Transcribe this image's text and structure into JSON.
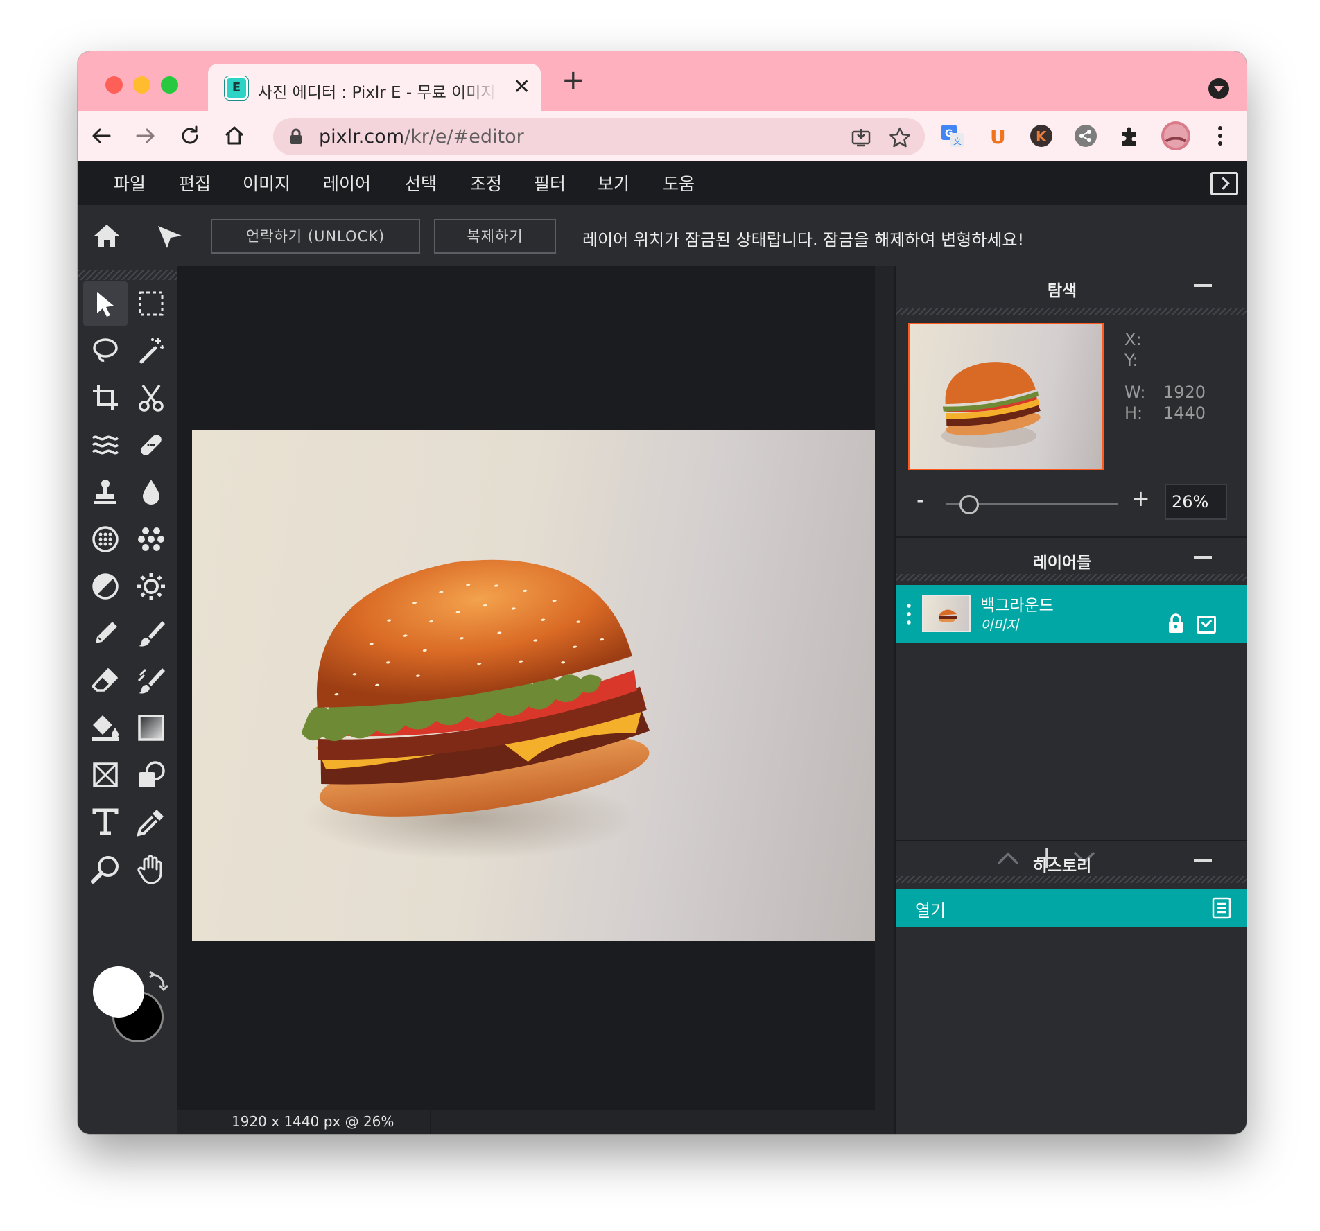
{
  "browser": {
    "tab_title": "사진 에디터 : Pixlr E - 무료 이미지 편집기",
    "tab_favicon_letter": "E",
    "new_tab_label": "+",
    "close_tab_label": "✕",
    "url_host": "pixlr.com",
    "url_path": "/kr/e/#editor"
  },
  "menu": {
    "items": [
      "파일",
      "편집",
      "이미지",
      "레이어",
      "선택",
      "조정",
      "필터",
      "보기",
      "도움"
    ]
  },
  "options": {
    "unlock_label": "언락하기 (UNLOCK)",
    "duplicate_label": "복제하기",
    "message": "레이어 위치가 잠금된 상태랍니다. 잠금을 해제하여 변형하세요!"
  },
  "navigator": {
    "title": "탐색",
    "x_label": "X:",
    "y_label": "Y:",
    "w_label": "W:",
    "h_label": "H:",
    "x_value": "",
    "y_value": "",
    "w_value": "1920",
    "h_value": "1440",
    "zoom_minus": "-",
    "zoom_plus": "+",
    "zoom_value": "26%",
    "zoom_fraction": 0.09
  },
  "layers": {
    "title": "레이어들",
    "items": [
      {
        "name": "백그라운드",
        "type": "이미지"
      }
    ]
  },
  "history": {
    "title": "히스토리",
    "items": [
      "열기"
    ]
  },
  "status": {
    "text": "1920 x 1440 px @ 26%"
  },
  "colors": {
    "accent": "#00a7a4",
    "tabstrip": "#ffb0be",
    "foreground_swatch": "#ffffff",
    "background_swatch": "#000000"
  }
}
